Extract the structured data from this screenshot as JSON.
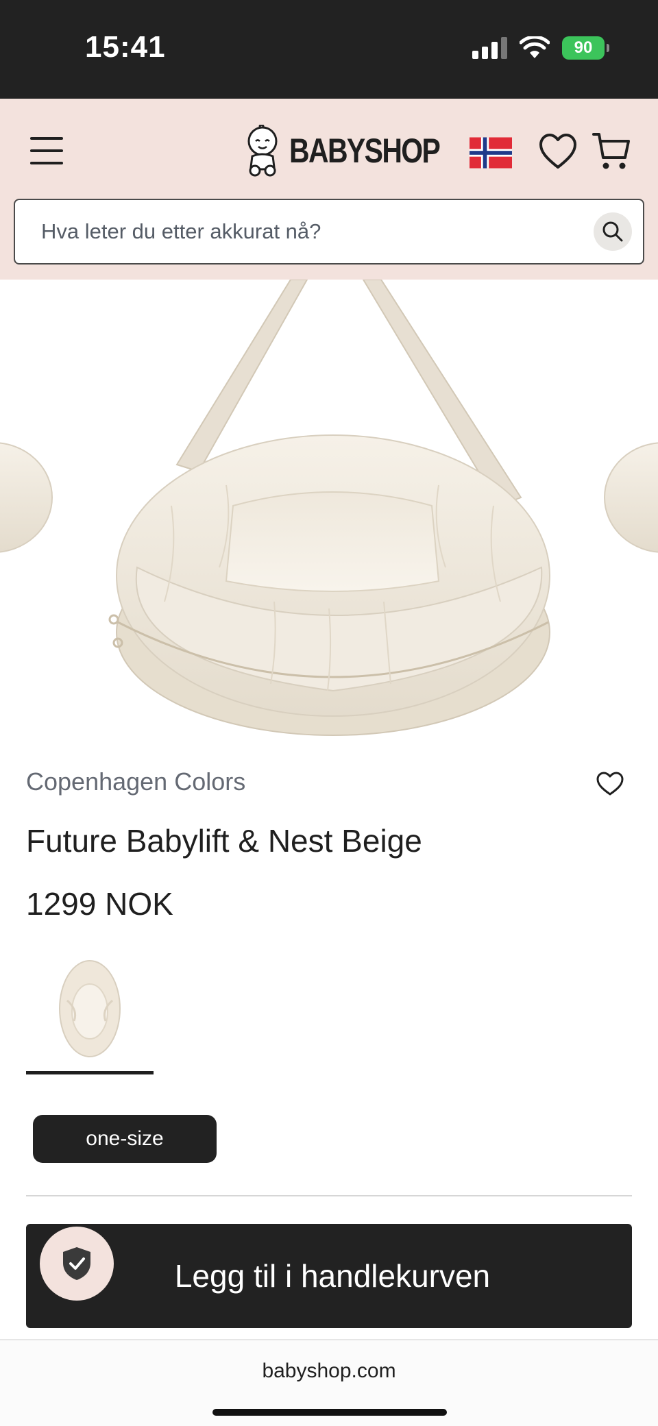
{
  "status_bar": {
    "time": "15:41",
    "battery": "90"
  },
  "header": {
    "logo_text": "BABYSHOP",
    "search": {
      "placeholder": "Hva leter du etter akkurat nå?"
    },
    "icons": [
      "menu-icon",
      "babyshop-logo",
      "norway-flag-icon",
      "heart-icon",
      "cart-icon",
      "search-icon"
    ]
  },
  "product": {
    "brand": "Copenhagen Colors",
    "title": "Future Babylift & Nest Beige",
    "price": "1299 NOK",
    "size_option": "one-size",
    "add_to_cart_label": "Legg til i handlekurven"
  },
  "browser": {
    "url": "babyshop.com"
  },
  "colors": {
    "header_bg": "#f3e2dd",
    "dark": "#222222",
    "brand_text": "#646973",
    "battery_green": "#3cc45b"
  }
}
